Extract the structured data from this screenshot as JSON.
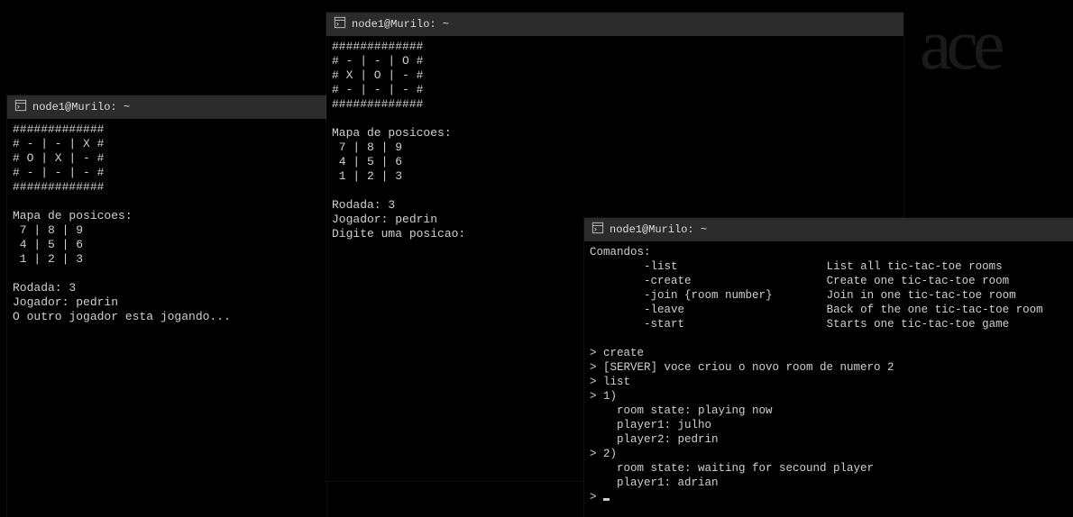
{
  "windows": {
    "left": {
      "title": "node1@Murilo: ~",
      "board_border": "#############",
      "board_rows": [
        "# - | - | X #",
        "# O | X | - #",
        "# - | - | - #"
      ],
      "pos_heading": "Mapa de posicoes:",
      "pos_rows": [
        " 7 | 8 | 9",
        " 4 | 5 | 6",
        " 1 | 2 | 3"
      ],
      "round_label": "Rodada: 3",
      "player_label": "Jogador: pedrin",
      "status": "O outro jogador esta jogando..."
    },
    "mid": {
      "title": "node1@Murilo: ~",
      "board_border": "#############",
      "board_rows": [
        "# - | - | O #",
        "# X | O | - #",
        "# - | - | - #"
      ],
      "pos_heading": "Mapa de posicoes:",
      "pos_rows": [
        " 7 | 8 | 9",
        " 4 | 5 | 6",
        " 1 | 2 | 3"
      ],
      "round_label": "Rodada: 3",
      "player_label": "Jogador: pedrin",
      "prompt": "Digite uma posicao:"
    },
    "right": {
      "title": "node1@Murilo: ~",
      "cmds_heading": "Comandos:",
      "commands": [
        {
          "flag": "-list",
          "desc": "List all tic-tac-toe rooms"
        },
        {
          "flag": "-create",
          "desc": "Create one tic-tac-toe room"
        },
        {
          "flag": "-join {room number}",
          "desc": "Join in one tic-tac-toe room"
        },
        {
          "flag": "-leave",
          "desc": "Back of the one tic-tac-toe room"
        },
        {
          "flag": "-start",
          "desc": "Starts one tic-tac-toe game"
        }
      ],
      "log": [
        "> create",
        "> [SERVER] voce criou o novo room de numero 2",
        "> list",
        "> 1)",
        "    room state: playing now",
        "    player1: julho",
        "    player2: pedrin",
        "> 2)",
        "    room state: waiting for secound player",
        "    player1: adrian"
      ],
      "prompt_prefix": "> "
    }
  }
}
